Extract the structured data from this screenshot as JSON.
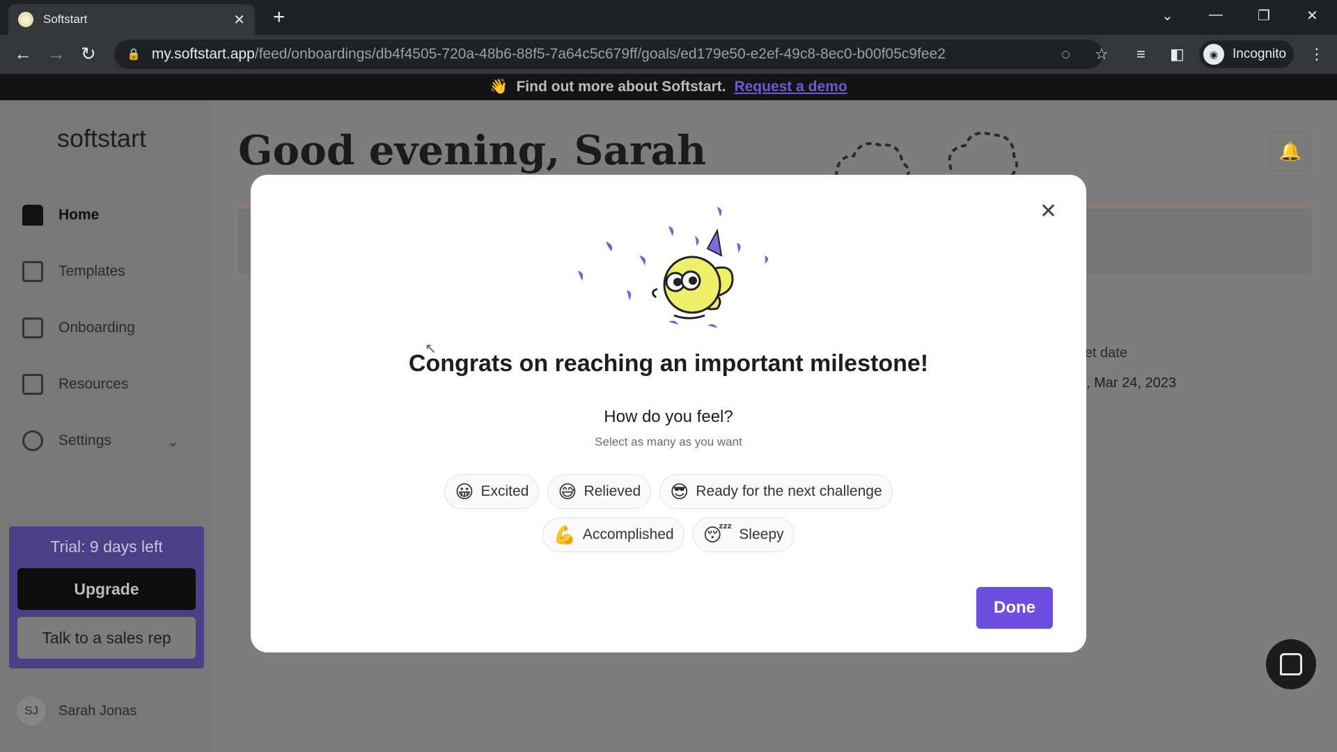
{
  "browser": {
    "tab_title": "Softstart",
    "url_host": "my.softstart.app",
    "url_path": "/feed/onboardings/db4f4505-720a-48b6-88f5-7a64c5c679ff/goals/ed179e50-e2ef-49c8-8ec0-b00f05c9fee2",
    "profile_label": "Incognito"
  },
  "banner": {
    "text": "Find out more about Softstart.",
    "link": "Request a demo"
  },
  "sidebar": {
    "logo": "softstart",
    "items": [
      {
        "label": "Home",
        "icon": "home-icon"
      },
      {
        "label": "Templates",
        "icon": "templates-icon"
      },
      {
        "label": "Onboarding",
        "icon": "calendar-icon"
      },
      {
        "label": "Resources",
        "icon": "book-icon"
      },
      {
        "label": "Settings",
        "icon": "gear-icon"
      }
    ],
    "trial_text": "Trial: 9 days left",
    "upgrade_label": "Upgrade",
    "sales_label": "Talk to a sales rep",
    "user_initials": "SJ",
    "user_name": "Sarah Jonas"
  },
  "main": {
    "greeting": "Good evening, Sarah",
    "target_label": "rget date",
    "target_value": ", Mar 24, 2023"
  },
  "modal": {
    "title": "Congrats on reaching an important milestone!",
    "question": "How do you feel?",
    "hint": "Select as many as you want",
    "feelings": [
      {
        "emoji": "😀",
        "label": "Excited"
      },
      {
        "emoji": "😅",
        "label": "Relieved"
      },
      {
        "emoji": "😎",
        "label": "Ready for the next challenge"
      },
      {
        "emoji": "💪",
        "label": "Accomplished"
      },
      {
        "emoji": "😴",
        "label": "Sleepy"
      }
    ],
    "done_label": "Done"
  },
  "colors": {
    "accent": "#6c4fe0",
    "trial_bg": "#4b3f86",
    "banner_link": "#6b5bd6"
  }
}
